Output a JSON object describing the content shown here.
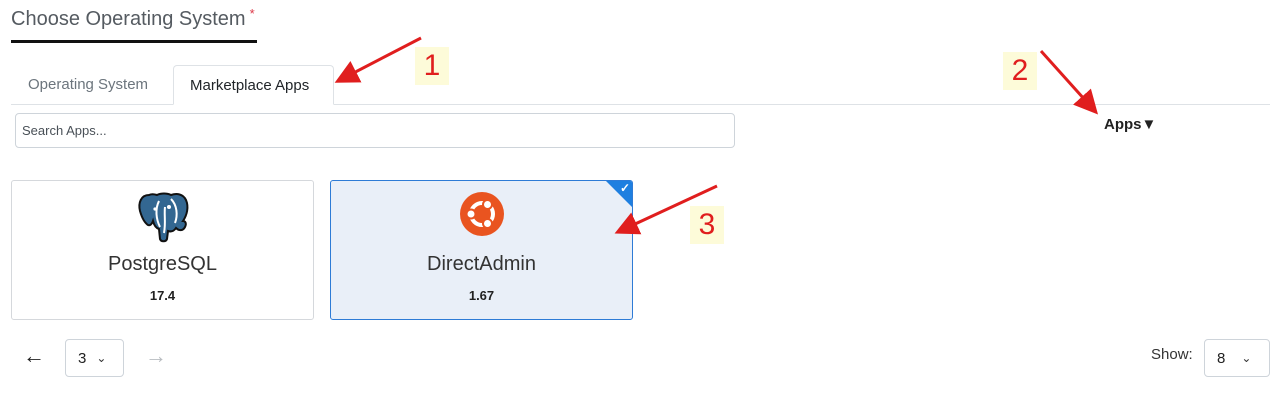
{
  "header": {
    "title": "Choose Operating System",
    "required_mark": "*"
  },
  "tabs": [
    {
      "label": "Operating System",
      "active": false
    },
    {
      "label": "Marketplace Apps",
      "active": true
    }
  ],
  "search": {
    "placeholder": "Search Apps...",
    "value": ""
  },
  "filter": {
    "label": "Apps▼"
  },
  "apps": [
    {
      "name": "PostgreSQL",
      "version": "17.4",
      "icon": "postgresql-elephant-icon",
      "selected": false
    },
    {
      "name": "DirectAdmin",
      "version": "1.67",
      "icon": "ubuntu-icon",
      "selected": true
    }
  ],
  "pagination": {
    "prev_symbol": "←",
    "next_symbol": "→",
    "current_page": "3",
    "show_label": "Show:",
    "page_size": "8"
  },
  "annotations": [
    {
      "label": "1"
    },
    {
      "label": "2"
    },
    {
      "label": "3"
    }
  ],
  "colors": {
    "accent": "#1e7fe0",
    "selected_bg": "#e9eff8",
    "annotation_red": "#e01e1e",
    "annotation_bg": "#fdfbd9",
    "ubuntu_orange": "#e95420",
    "postgres_blue": "#336791"
  }
}
